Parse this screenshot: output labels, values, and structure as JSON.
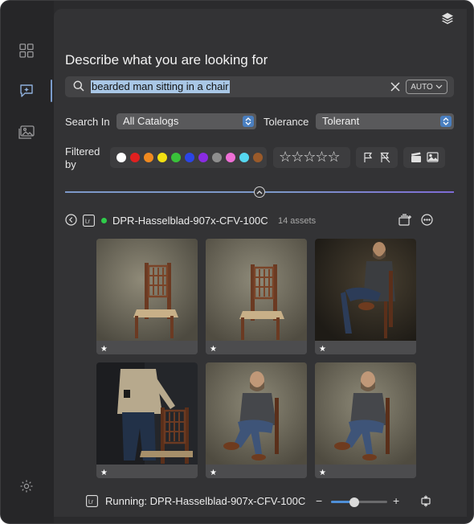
{
  "window": {
    "traffic_lights": [
      "close",
      "minimize",
      "zoom"
    ]
  },
  "sidebar": {
    "items": [
      {
        "name": "grid-icon",
        "active": false
      },
      {
        "name": "ai-search-icon",
        "active": true
      },
      {
        "name": "image-library-icon",
        "active": false
      },
      {
        "name": "settings-icon",
        "active": false
      }
    ],
    "accent": "#7a9ccc"
  },
  "main": {
    "heading": "Describe what you are looking for",
    "search": {
      "value": "bearded man sitting in a chair",
      "mode_label": "AUTO"
    },
    "search_in": {
      "label": "Search In",
      "selected": "All Catalogs"
    },
    "tolerance": {
      "label": "Tolerance",
      "selected": "Tolerant"
    },
    "filters": {
      "label": "Filtered by",
      "color_labels": [
        "#ffffff",
        "#e02020",
        "#f08a20",
        "#f2e012",
        "#39c23a",
        "#2b45e6",
        "#8a2be2",
        "#8e8e8e",
        "#ee6fd6",
        "#55d7f0",
        "#9a5a2a"
      ],
      "stars": "☆☆☆☆☆",
      "flag_icons": [
        "flag-icon",
        "flag-rejected-icon"
      ],
      "type_icons": [
        "video-icon",
        "photo-icon"
      ]
    },
    "catalog": {
      "name": "DPR-Hasselblad-907x-CFV-100C",
      "count": "14 assets",
      "status_color": "#2fcc4a"
    },
    "thumbnails": [
      {
        "subject": "chair",
        "star": "★"
      },
      {
        "subject": "chair",
        "star": "★"
      },
      {
        "subject": "man-chair-dark",
        "star": "★"
      },
      {
        "subject": "man-standing-chair",
        "star": "★"
      },
      {
        "subject": "man-chair",
        "star": "★"
      },
      {
        "subject": "man-chair",
        "star": "★"
      }
    ],
    "status": {
      "running_text": "Running: DPR-Hasselblad-907x-CFV-100C",
      "minus": "−",
      "plus": "+",
      "zoom_fraction": 0.42
    }
  }
}
